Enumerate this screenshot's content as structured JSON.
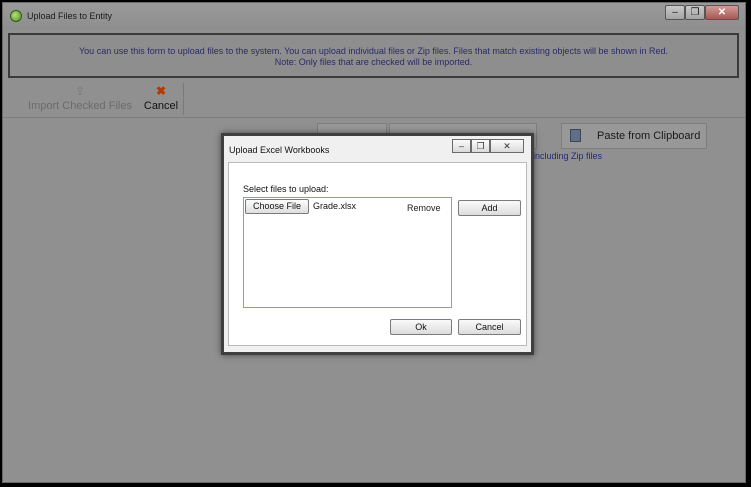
{
  "window": {
    "title": "Upload Files to Entity",
    "min_glyph": "–",
    "max_glyph": "❐",
    "close_glyph": "✕"
  },
  "info": {
    "line1": "You can use this form to upload files to the system. You can upload individual files or Zip files. Files that match existing objects will be shown in Red.",
    "line2": "Note: Only files that are checked will be imported."
  },
  "toolbar": {
    "import_label": "Import Checked Files",
    "import_icon": "upload-icon",
    "cancel_label": "Cancel",
    "cancel_icon": "x-icon"
  },
  "background": {
    "paste_label": "Paste from Clipboard",
    "sub_text": "including Zip files"
  },
  "dialog": {
    "title": "Upload Excel Workbooks",
    "min_glyph": "–",
    "max_glyph": "❐",
    "close_glyph": "✕",
    "select_label": "Select files to upload:",
    "choose_file_label": "Choose File",
    "file_name": "Grade.xlsx",
    "remove_label": "Remove",
    "add_label": "Add",
    "ok_label": "Ok",
    "cancel_label": "Cancel"
  },
  "colors": {
    "info_text": "#2a2a6a",
    "link_text": "#242a78",
    "cancel_icon": "#b03a00"
  }
}
